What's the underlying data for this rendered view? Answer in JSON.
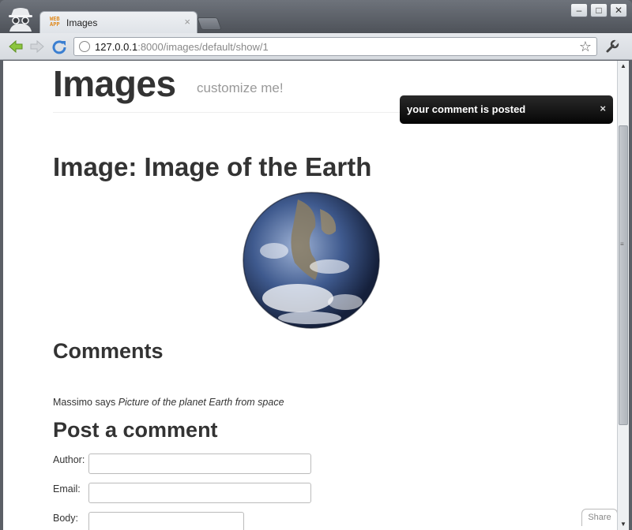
{
  "browser": {
    "tab_title": "Images",
    "tab_favicon": "WEB APP",
    "url_host": "127.0.0.1",
    "url_rest": ":8000/images/default/show/1",
    "window_buttons": [
      "minimize",
      "maximize",
      "close"
    ]
  },
  "page": {
    "site_title": "Images",
    "site_subtitle": "customize me!",
    "flash_message": "your comment is posted",
    "flash_close": "×",
    "image_heading": "Image: Image of the Earth",
    "comments_heading": "Comments",
    "comment_author": "Massimo",
    "comment_says": "says",
    "comment_body": "Picture of the planet Earth from space",
    "post_heading": "Post a comment",
    "form": {
      "author_label": "Author:",
      "email_label": "Email:",
      "body_label": "Body:",
      "author_value": "",
      "email_value": "",
      "body_value": ""
    },
    "share_label": "Share"
  },
  "colors": {
    "heading": "#333333",
    "subtitle": "#999999",
    "flash_bg": "#111111"
  }
}
